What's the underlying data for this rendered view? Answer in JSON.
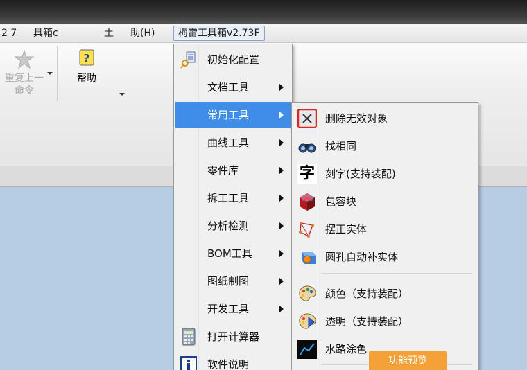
{
  "menubar": {
    "items": [
      {
        "label": "2 7"
      },
      {
        "label": "具箱c"
      },
      {
        "label": "土"
      },
      {
        "label": "助(H)"
      },
      {
        "label": "梅雷工具箱v2.73F"
      }
    ]
  },
  "ribbon": {
    "redo": {
      "label_line1": "重复上一",
      "label_line2": "命令"
    },
    "help": {
      "label": "帮助"
    }
  },
  "main_menu": {
    "items": [
      {
        "label": "初始化配置",
        "icon": "key-icon",
        "has_submenu": false
      },
      {
        "label": "文档工具",
        "has_submenu": true
      },
      {
        "label": "常用工具",
        "has_submenu": true,
        "highlighted": true
      },
      {
        "label": "曲线工具",
        "has_submenu": true
      },
      {
        "label": "零件库",
        "has_submenu": true
      },
      {
        "label": "拆工工具",
        "has_submenu": true
      },
      {
        "label": "分析检测",
        "has_submenu": true
      },
      {
        "label": "BOM工具",
        "has_submenu": true
      },
      {
        "label": "图纸制图",
        "has_submenu": true
      },
      {
        "label": "开发工具",
        "has_submenu": true
      },
      {
        "label": "打开计算器",
        "icon": "calculator-icon",
        "has_submenu": false
      },
      {
        "label": "软件说明",
        "icon": "info-icon",
        "has_submenu": false
      }
    ]
  },
  "submenu": {
    "items": [
      {
        "label": "删除无效对象",
        "icon": "delete-x-icon"
      },
      {
        "label": "找相同",
        "icon": "binoculars-icon"
      },
      {
        "label": "刻字(支持装配)",
        "icon": "character-icon",
        "icon_text": "字"
      },
      {
        "label": "包容块",
        "icon": "red-cube-icon"
      },
      {
        "label": "摆正实体",
        "icon": "align-solid-icon"
      },
      {
        "label": "圆孔自动补实体",
        "icon": "fill-hole-icon"
      },
      {
        "label": "颜色（支持装配）",
        "icon": "palette-icon"
      },
      {
        "label": "透明（支持装配）",
        "icon": "transparent-palette-icon"
      },
      {
        "label": "水路涂色",
        "icon": "waterline-icon"
      }
    ]
  },
  "tooltip": {
    "label": "功能预览"
  },
  "colors": {
    "highlight": "#3f8de8",
    "tooltip": "#f5a13a",
    "background": "#b7cde3"
  }
}
